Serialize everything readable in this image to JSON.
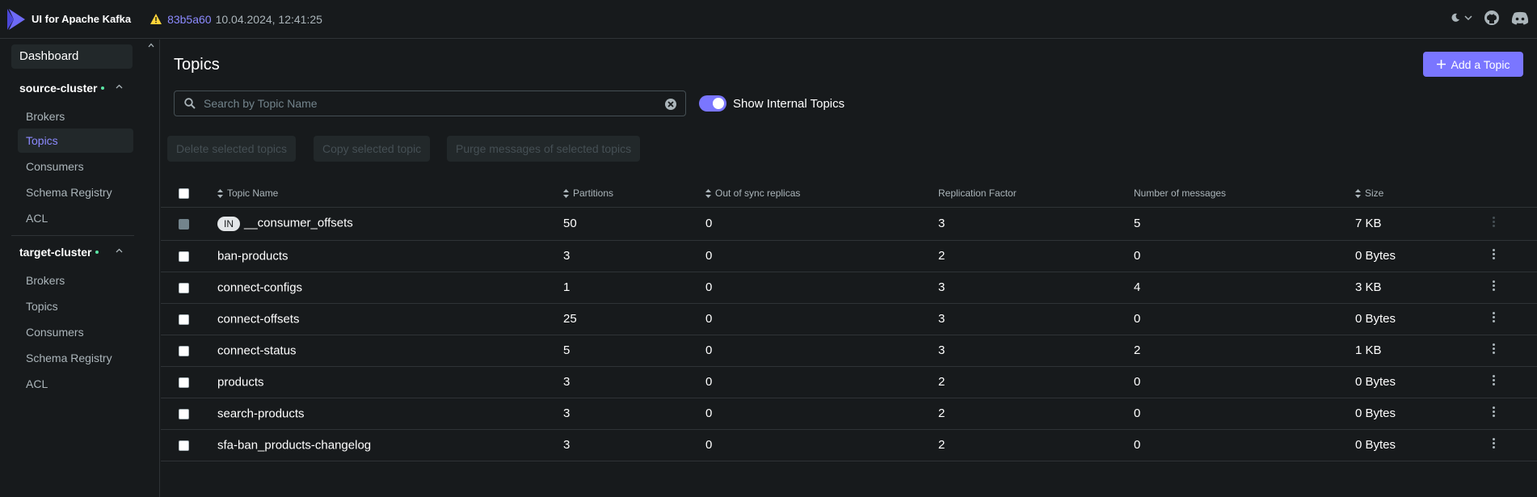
{
  "header": {
    "app_title": "UI for Apache Kafka",
    "commit": "83b5a60",
    "build_date": "10.04.2024, 12:41:25"
  },
  "sidebar": {
    "dashboard": "Dashboard",
    "clusters": [
      {
        "name": "source-cluster",
        "items": [
          "Brokers",
          "Topics",
          "Consumers",
          "Schema Registry",
          "ACL"
        ]
      },
      {
        "name": "target-cluster",
        "items": [
          "Brokers",
          "Topics",
          "Consumers",
          "Schema Registry",
          "ACL"
        ]
      }
    ]
  },
  "main": {
    "title": "Topics",
    "add_button": "Add a Topic",
    "search_placeholder": "Search by Topic Name",
    "toggle_label": "Show Internal Topics",
    "bulk_actions": [
      "Delete selected topics",
      "Copy selected topic",
      "Purge messages of selected topics"
    ],
    "columns": [
      "Topic Name",
      "Partitions",
      "Out of sync replicas",
      "Replication Factor",
      "Number of messages",
      "Size"
    ],
    "internal_badge": "IN",
    "rows": [
      {
        "name": "__consumer_offsets",
        "partitions": "50",
        "out_of_sync": "0",
        "replication": "3",
        "messages": "5",
        "size": "7 KB"
      },
      {
        "name": "ban-products",
        "partitions": "3",
        "out_of_sync": "0",
        "replication": "2",
        "messages": "0",
        "size": "0 Bytes"
      },
      {
        "name": "connect-configs",
        "partitions": "1",
        "out_of_sync": "0",
        "replication": "3",
        "messages": "4",
        "size": "3 KB"
      },
      {
        "name": "connect-offsets",
        "partitions": "25",
        "out_of_sync": "0",
        "replication": "3",
        "messages": "0",
        "size": "0 Bytes"
      },
      {
        "name": "connect-status",
        "partitions": "5",
        "out_of_sync": "0",
        "replication": "3",
        "messages": "2",
        "size": "1 KB"
      },
      {
        "name": "products",
        "partitions": "3",
        "out_of_sync": "0",
        "replication": "2",
        "messages": "0",
        "size": "0 Bytes"
      },
      {
        "name": "search-products",
        "partitions": "3",
        "out_of_sync": "0",
        "replication": "2",
        "messages": "0",
        "size": "0 Bytes"
      },
      {
        "name": "sfa-ban_products-changelog",
        "partitions": "3",
        "out_of_sync": "0",
        "replication": "2",
        "messages": "0",
        "size": "0 Bytes"
      }
    ]
  },
  "colors": {
    "accent": "#7A76FF",
    "link": "#8C8AFF",
    "online": "#5BE6A5",
    "background": "#171A1C"
  },
  "icons": [
    "logo-icon",
    "warning-icon",
    "moon-icon",
    "chevron-down-icon",
    "github-icon",
    "discord-icon",
    "search-icon",
    "clear-icon",
    "plus-icon",
    "sort-icon",
    "kebab-icon"
  ]
}
